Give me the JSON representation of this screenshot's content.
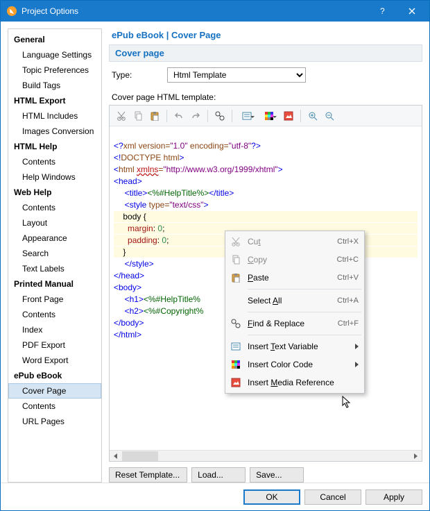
{
  "window": {
    "title": "Project Options"
  },
  "sidebar": {
    "groups": [
      {
        "label": "General",
        "items": [
          "Language Settings",
          "Topic Preferences",
          "Build Tags"
        ]
      },
      {
        "label": "HTML Export",
        "items": [
          "HTML Includes",
          "Images Conversion"
        ]
      },
      {
        "label": "HTML Help",
        "items": [
          "Contents",
          "Help Windows"
        ]
      },
      {
        "label": "Web Help",
        "items": [
          "Contents",
          "Layout",
          "Appearance",
          "Search",
          "Text Labels"
        ]
      },
      {
        "label": "Printed Manual",
        "items": [
          "Front Page",
          "Contents",
          "Index",
          "PDF Export",
          "Word Export"
        ]
      },
      {
        "label": "ePub eBook",
        "items": [
          "Cover Page",
          "Contents",
          "URL Pages"
        ]
      }
    ],
    "active": "Cover Page"
  },
  "main": {
    "breadcrumb": "ePub eBook | Cover Page",
    "section": "Cover page",
    "type_label": "Type:",
    "type_value": "Html Template",
    "template_label": "Cover page HTML template:",
    "buttons": {
      "reset": "Reset Template...",
      "load": "Load...",
      "save": "Save..."
    }
  },
  "code": {
    "l1a": "<?",
    "l1b": "xml version=",
    "l1c": "\"1.0\"",
    "l1d": " encoding=",
    "l1e": "\"utf-8\"",
    "l1f": "?>",
    "l2a": "<!",
    "l2b": "DOCTYPE html",
    "l2c": ">",
    "l3a": "<",
    "l3b": "html ",
    "l3c": "xmlns",
    "l3d": "=",
    "l3e": "\"http://www.w3.org/1999/xhtml\"",
    "l3f": ">",
    "l4": "<head>",
    "l5a": "<title>",
    "l5b": "<%#HelpTitle%>",
    "l5c": "</title>",
    "l6a": "<style ",
    "l6b": "type",
    "l6c": "=",
    "l6d": "\"text/css\"",
    "l6e": ">",
    "l7": "body {",
    "l8a": "margin",
    "l8b": ": ",
    "l8c": "0",
    "l8d": ";",
    "l9a": "padding",
    "l9b": ": ",
    "l9c": "0",
    "l9d": ";",
    "l10": "}",
    "l11": "</style>",
    "l12": "</head>",
    "l13": "<body>",
    "l14a": "<h1>",
    "l14b": "<%#HelpTitle%",
    "l14_suffix": "",
    "l15a": "<h2>",
    "l15b": "<%#Copyright%",
    "l15_suffix": "",
    "l16": "</body>",
    "l17": "</html>"
  },
  "menu": {
    "items": [
      {
        "icon": "cut",
        "label": "Cut",
        "mn": "t",
        "shortcut": "Ctrl+X",
        "disabled": true
      },
      {
        "icon": "copy",
        "label": "Copy",
        "mn": "C",
        "shortcut": "Ctrl+C",
        "disabled": true
      },
      {
        "icon": "paste",
        "label": "Paste",
        "mn": "P",
        "shortcut": "Ctrl+V"
      },
      {
        "sep": true
      },
      {
        "icon": "",
        "label": "Select All",
        "mn": "A",
        "shortcut": "Ctrl+A"
      },
      {
        "sep": true
      },
      {
        "icon": "find",
        "label": "Find & Replace",
        "mn": "F",
        "shortcut": "Ctrl+F"
      },
      {
        "sep": true
      },
      {
        "icon": "textvar",
        "label": "Insert Text Variable",
        "mn": "T",
        "sub": true
      },
      {
        "icon": "color",
        "label": "Insert Color Code",
        "sub": true
      },
      {
        "icon": "media",
        "label": "Insert Media Reference",
        "mn": "M"
      }
    ]
  },
  "footer": {
    "ok": "OK",
    "cancel": "Cancel",
    "apply": "Apply"
  },
  "icons": {
    "cut": "cut-icon",
    "copy": "copy-icon",
    "paste": "paste-icon",
    "undo": "undo-icon",
    "redo": "redo-icon",
    "find": "find-icon",
    "textvar": "textvar-icon",
    "color": "color-icon",
    "media": "media-icon",
    "zoomin": "zoom-in-icon",
    "zoomout": "zoom-out-icon"
  }
}
